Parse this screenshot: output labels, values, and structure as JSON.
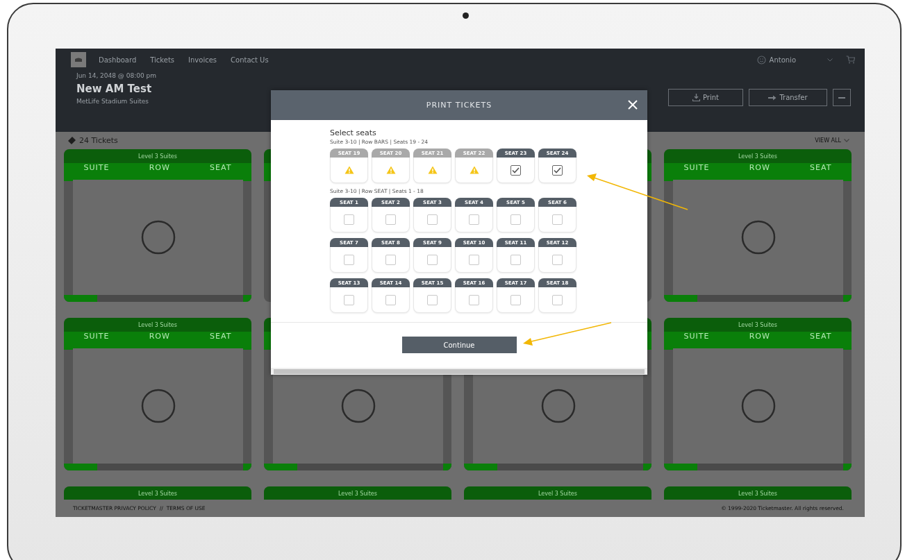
{
  "header": {
    "nav": [
      {
        "label": "Dashboard"
      },
      {
        "label": "Tickets"
      },
      {
        "label": "Invoices"
      },
      {
        "label": "Contact Us"
      }
    ],
    "user": "Antonio",
    "event_date": "Jun 14, 2048 @ 08:00 pm",
    "event_title": "New AM Test",
    "venue": "MetLife Stadium Suites",
    "actions": [
      {
        "kind": "print",
        "label": "Print"
      },
      {
        "kind": "transfer",
        "label": "Transfer"
      },
      {
        "kind": "more"
      }
    ]
  },
  "tickets_bar": {
    "count": "24 Tickets",
    "view_all": "VIEW ALL"
  },
  "cards": [
    {
      "kind": "ticket",
      "section": "Level 3 Suites",
      "columns": [
        "SUITE",
        "ROW",
        "SEAT"
      ]
    },
    {
      "kind": "hidden"
    },
    {
      "kind": "hidden"
    },
    {
      "kind": "ticket",
      "section": "Level 3 Suites",
      "columns": [
        "SUITE",
        "ROW",
        "SEAT"
      ]
    },
    {
      "kind": "ticket",
      "section": "Level 3 Suites",
      "columns": [
        "SUITE",
        "ROW",
        "SEAT"
      ]
    },
    {
      "kind": "covered"
    },
    {
      "kind": "covered"
    },
    {
      "kind": "ticket",
      "section": "Level 3 Suites",
      "columns": [
        "SUITE",
        "ROW",
        "SEAT"
      ]
    },
    {
      "kind": "partial",
      "section": "Level 3 Suites"
    },
    {
      "kind": "partial",
      "section": "Level 3 Suites"
    },
    {
      "kind": "partial",
      "section": "Level 3 Suites"
    },
    {
      "kind": "partial",
      "section": "Level 3 Suites"
    }
  ],
  "modal": {
    "title": "PRINT TICKETS",
    "heading": "Select seats",
    "groups": [
      {
        "caption": "Suite 3-10 | Row BARS | Seats 19 - 24",
        "seats": [
          {
            "label": "SEAT 19",
            "kind": "unavailable"
          },
          {
            "label": "SEAT 20",
            "kind": "unavailable"
          },
          {
            "label": "SEAT 21",
            "kind": "unavailable"
          },
          {
            "label": "SEAT 22",
            "kind": "unavailable"
          },
          {
            "label": "SEAT 23",
            "kind": "available",
            "checked": true
          },
          {
            "label": "SEAT 24",
            "kind": "available",
            "checked": true
          }
        ]
      },
      {
        "caption": "Suite 3-10 | Row SEAT | Seats 1 - 18",
        "seats": [
          {
            "label": "SEAT 1",
            "kind": "available",
            "checked": false
          },
          {
            "label": "SEAT 2",
            "kind": "available",
            "checked": false
          },
          {
            "label": "SEAT 3",
            "kind": "available",
            "checked": false
          },
          {
            "label": "SEAT 4",
            "kind": "available",
            "checked": false
          },
          {
            "label": "SEAT 5",
            "kind": "available",
            "checked": false
          },
          {
            "label": "SEAT 6",
            "kind": "available",
            "checked": false
          },
          {
            "label": "SEAT 7",
            "kind": "available",
            "checked": false
          },
          {
            "label": "SEAT 8",
            "kind": "available",
            "checked": false
          },
          {
            "label": "SEAT 9",
            "kind": "available",
            "checked": false
          },
          {
            "label": "SEAT 10",
            "kind": "available",
            "checked": false
          },
          {
            "label": "SEAT 11",
            "kind": "available",
            "checked": false
          },
          {
            "label": "SEAT 12",
            "kind": "available",
            "checked": false
          },
          {
            "label": "SEAT 13",
            "kind": "available",
            "checked": false
          },
          {
            "label": "SEAT 14",
            "kind": "available",
            "checked": false
          },
          {
            "label": "SEAT 15",
            "kind": "available",
            "checked": false
          },
          {
            "label": "SEAT 16",
            "kind": "available",
            "checked": false
          },
          {
            "label": "SEAT 17",
            "kind": "available",
            "checked": false
          },
          {
            "label": "SEAT 18",
            "kind": "available",
            "checked": false
          }
        ]
      }
    ],
    "continue": "Continue"
  },
  "footer": {
    "links": [
      "TICKETMASTER PRIVACY POLICY",
      "TERMS OF USE"
    ],
    "separator": "//",
    "copyright": "© 1999-2020 Ticketmaster. All rights reserved."
  }
}
